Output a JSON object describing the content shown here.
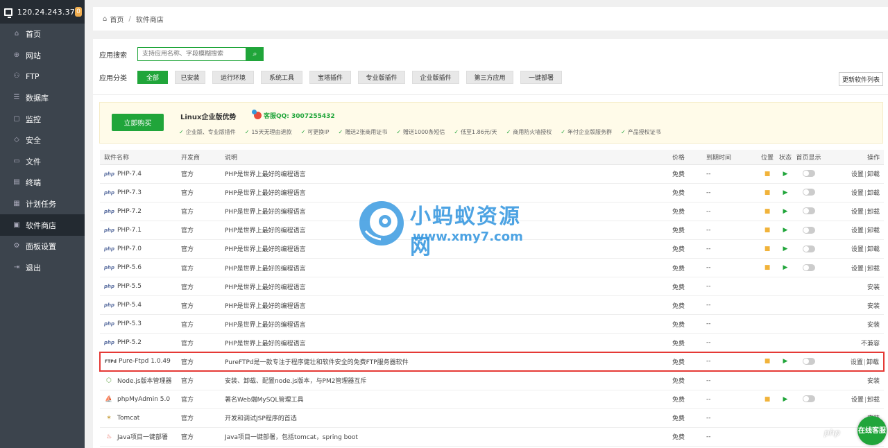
{
  "sidebar": {
    "server_ip": "120.24.243.37",
    "badge_count": "0",
    "items": [
      {
        "label": "首页",
        "icon": "home-icon",
        "glyph": "⌂"
      },
      {
        "label": "网站",
        "icon": "globe-icon",
        "glyph": "⊕"
      },
      {
        "label": "FTP",
        "icon": "ftp-icon",
        "glyph": "⚇"
      },
      {
        "label": "数据库",
        "icon": "database-icon",
        "glyph": "☰"
      },
      {
        "label": "监控",
        "icon": "monitor-icon",
        "glyph": "▢"
      },
      {
        "label": "安全",
        "icon": "shield-icon",
        "glyph": "◇"
      },
      {
        "label": "文件",
        "icon": "folder-icon",
        "glyph": "▭"
      },
      {
        "label": "终端",
        "icon": "terminal-icon",
        "glyph": "▤"
      },
      {
        "label": "计划任务",
        "icon": "calendar-icon",
        "glyph": "▦"
      },
      {
        "label": "软件商店",
        "icon": "apps-icon",
        "glyph": "▣",
        "active": true
      },
      {
        "label": "面板设置",
        "icon": "settings-icon",
        "glyph": "⚙"
      },
      {
        "label": "退出",
        "icon": "logout-icon",
        "glyph": "⇥"
      }
    ]
  },
  "breadcrumb": {
    "home": "首页",
    "separator": "/",
    "current": "软件商店"
  },
  "search": {
    "label": "应用搜索",
    "placeholder": "支持应用名称、字段模糊搜索"
  },
  "categories": {
    "label": "应用分类",
    "items": [
      "全部",
      "已安装",
      "运行环境",
      "系统工具",
      "宝塔插件",
      "专业版插件",
      "企业版插件",
      "第三方应用",
      "一键部署"
    ],
    "active": "全部"
  },
  "update_button": "更新软件列表",
  "promo": {
    "buy_label": "立即购买",
    "title": "Linux企业版优势",
    "qq": "客服QQ: 3007255432",
    "features": [
      "企业版、专业版插件",
      "15天无理由退款",
      "可更换IP",
      "赠送2张商用证书",
      "赠送1000条短信",
      "低至1.86元/天",
      "商用防火墙授权",
      "年付企业版服务群",
      "产品授权证书"
    ]
  },
  "table": {
    "headers": {
      "name": "软件名称",
      "developer": "开发商",
      "description": "说明",
      "price": "价格",
      "expire": "到期时间",
      "location": "位置",
      "status": "状态",
      "homepage": "首页显示",
      "actions": "操作"
    },
    "rows": [
      {
        "icon_text": "php",
        "icon_kind": "php",
        "name": "PHP-7.4",
        "dev": "官方",
        "desc": "PHP是世界上最好的编程语言",
        "price": "免费",
        "expire": "--",
        "installed": true,
        "action1": "设置",
        "action2": "卸载"
      },
      {
        "icon_text": "php",
        "icon_kind": "php",
        "name": "PHP-7.3",
        "dev": "官方",
        "desc": "PHP是世界上最好的编程语言",
        "price": "免费",
        "expire": "--",
        "installed": true,
        "action1": "设置",
        "action2": "卸载"
      },
      {
        "icon_text": "php",
        "icon_kind": "php",
        "name": "PHP-7.2",
        "dev": "官方",
        "desc": "PHP是世界上最好的编程语言",
        "price": "免费",
        "expire": "--",
        "installed": true,
        "action1": "设置",
        "action2": "卸载"
      },
      {
        "icon_text": "php",
        "icon_kind": "php",
        "name": "PHP-7.1",
        "dev": "官方",
        "desc": "PHP是世界上最好的编程语言",
        "price": "免费",
        "expire": "--",
        "installed": true,
        "action1": "设置",
        "action2": "卸载"
      },
      {
        "icon_text": "php",
        "icon_kind": "php",
        "name": "PHP-7.0",
        "dev": "官方",
        "desc": "PHP是世界上最好的编程语言",
        "price": "免费",
        "expire": "--",
        "installed": true,
        "action1": "设置",
        "action2": "卸载"
      },
      {
        "icon_text": "php",
        "icon_kind": "php",
        "name": "PHP-5.6",
        "dev": "官方",
        "desc": "PHP是世界上最好的编程语言",
        "price": "免费",
        "expire": "--",
        "installed": true,
        "action1": "设置",
        "action2": "卸载"
      },
      {
        "icon_text": "php",
        "icon_kind": "php",
        "name": "PHP-5.5",
        "dev": "官方",
        "desc": "PHP是世界上最好的编程语言",
        "price": "免费",
        "expire": "--",
        "installed": false,
        "action1": "安装"
      },
      {
        "icon_text": "php",
        "icon_kind": "php",
        "name": "PHP-5.4",
        "dev": "官方",
        "desc": "PHP是世界上最好的编程语言",
        "price": "免费",
        "expire": "--",
        "installed": false,
        "action1": "安装"
      },
      {
        "icon_text": "php",
        "icon_kind": "php",
        "name": "PHP-5.3",
        "dev": "官方",
        "desc": "PHP是世界上最好的编程语言",
        "price": "免费",
        "expire": "--",
        "installed": false,
        "action1": "安装"
      },
      {
        "icon_text": "php",
        "icon_kind": "php",
        "name": "PHP-5.2",
        "dev": "官方",
        "desc": "PHP是世界上最好的编程语言",
        "price": "免费",
        "expire": "--",
        "installed": false,
        "action1": "不兼容",
        "incompatible": true
      },
      {
        "icon_text": "FTPd",
        "icon_kind": "ftp",
        "name": "Pure-Ftpd 1.0.49",
        "dev": "官方",
        "desc": "PureFTPd是一款专注于程序健壮和软件安全的免费FTP服务器软件",
        "price": "免费",
        "expire": "--",
        "installed": true,
        "action1": "设置",
        "action2": "卸载",
        "highlight": true
      },
      {
        "icon_text": "⬡",
        "icon_kind": "node",
        "name": "Node.js版本管理器",
        "dev": "官方",
        "desc": "安装、卸载、配置node.js版本，与PM2管理器互斥",
        "price": "免费",
        "expire": "--",
        "installed": false,
        "action1": "安装"
      },
      {
        "icon_text": "⛵",
        "icon_kind": "pma",
        "name": "phpMyAdmin 5.0",
        "dev": "官方",
        "desc": "著名Web端MySQL管理工具",
        "price": "免费",
        "expire": "--",
        "installed": true,
        "action1": "设置",
        "action2": "卸载"
      },
      {
        "icon_text": "✶",
        "icon_kind": "tomcat",
        "name": "Tomcat",
        "dev": "官方",
        "desc": "开发和调试JSP程序的首选",
        "price": "免费",
        "expire": "--",
        "installed": false,
        "action1": "安装"
      },
      {
        "icon_text": "♨",
        "icon_kind": "java",
        "name": "Java项目一键部署",
        "dev": "官方",
        "desc": "Java项目一键部署，包括tomcat，spring boot",
        "price": "免费",
        "expire": "--",
        "installed": false,
        "action1": ""
      }
    ]
  },
  "watermark": {
    "title": "小蚂蚁资源网",
    "url": "www.xmy7.com"
  },
  "floating": {
    "php_mark": "php",
    "online_chat": "在线客服"
  },
  "colors": {
    "accent": "#20a53a",
    "sidebar_bg": "#3c444d",
    "highlight": "#e53935"
  }
}
